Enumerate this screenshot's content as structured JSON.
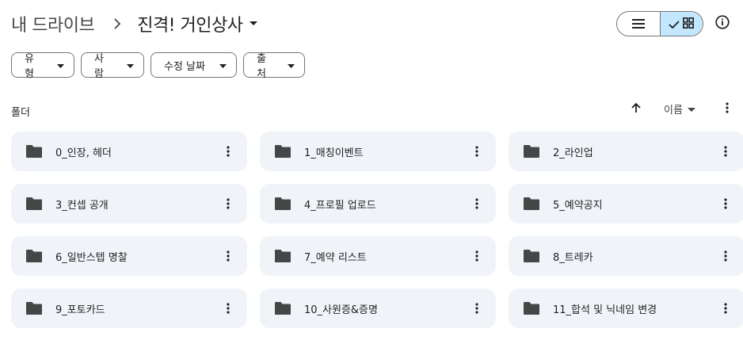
{
  "breadcrumb": {
    "root": "내 드라이브",
    "current": "진격! 거인상사"
  },
  "filters": [
    {
      "label": "유형"
    },
    {
      "label": "사람"
    },
    {
      "label": "수정 날짜"
    },
    {
      "label": "출처"
    }
  ],
  "section": {
    "label": "폴더"
  },
  "sort": {
    "label": "이름"
  },
  "icons": {
    "separator": "chevron-right-icon",
    "caret": "arrow-drop-down-icon",
    "list_view": "list-view-icon",
    "grid_view": "grid-view-icon",
    "info": "info-icon",
    "sort_direction": "arrow-upward-icon",
    "folder": "folder-icon",
    "more": "more-vert-icon"
  },
  "colors": {
    "accent_selected": "#c2e7ff",
    "card_bg": "#f0f4f9",
    "icon": "#444746"
  },
  "folders": [
    {
      "name": "0_인장, 헤더"
    },
    {
      "name": "1_매칭이벤트"
    },
    {
      "name": "2_라인업"
    },
    {
      "name": "3_컨셉 공개"
    },
    {
      "name": "4_프로필 업로드"
    },
    {
      "name": "5_예약공지"
    },
    {
      "name": "6_일반스텝 명찰"
    },
    {
      "name": "7_예약 리스트"
    },
    {
      "name": "8_트레카"
    },
    {
      "name": "9_포토카드"
    },
    {
      "name": "10_사원증&증명"
    },
    {
      "name": "11_합석 및 닉네임 변경"
    }
  ]
}
